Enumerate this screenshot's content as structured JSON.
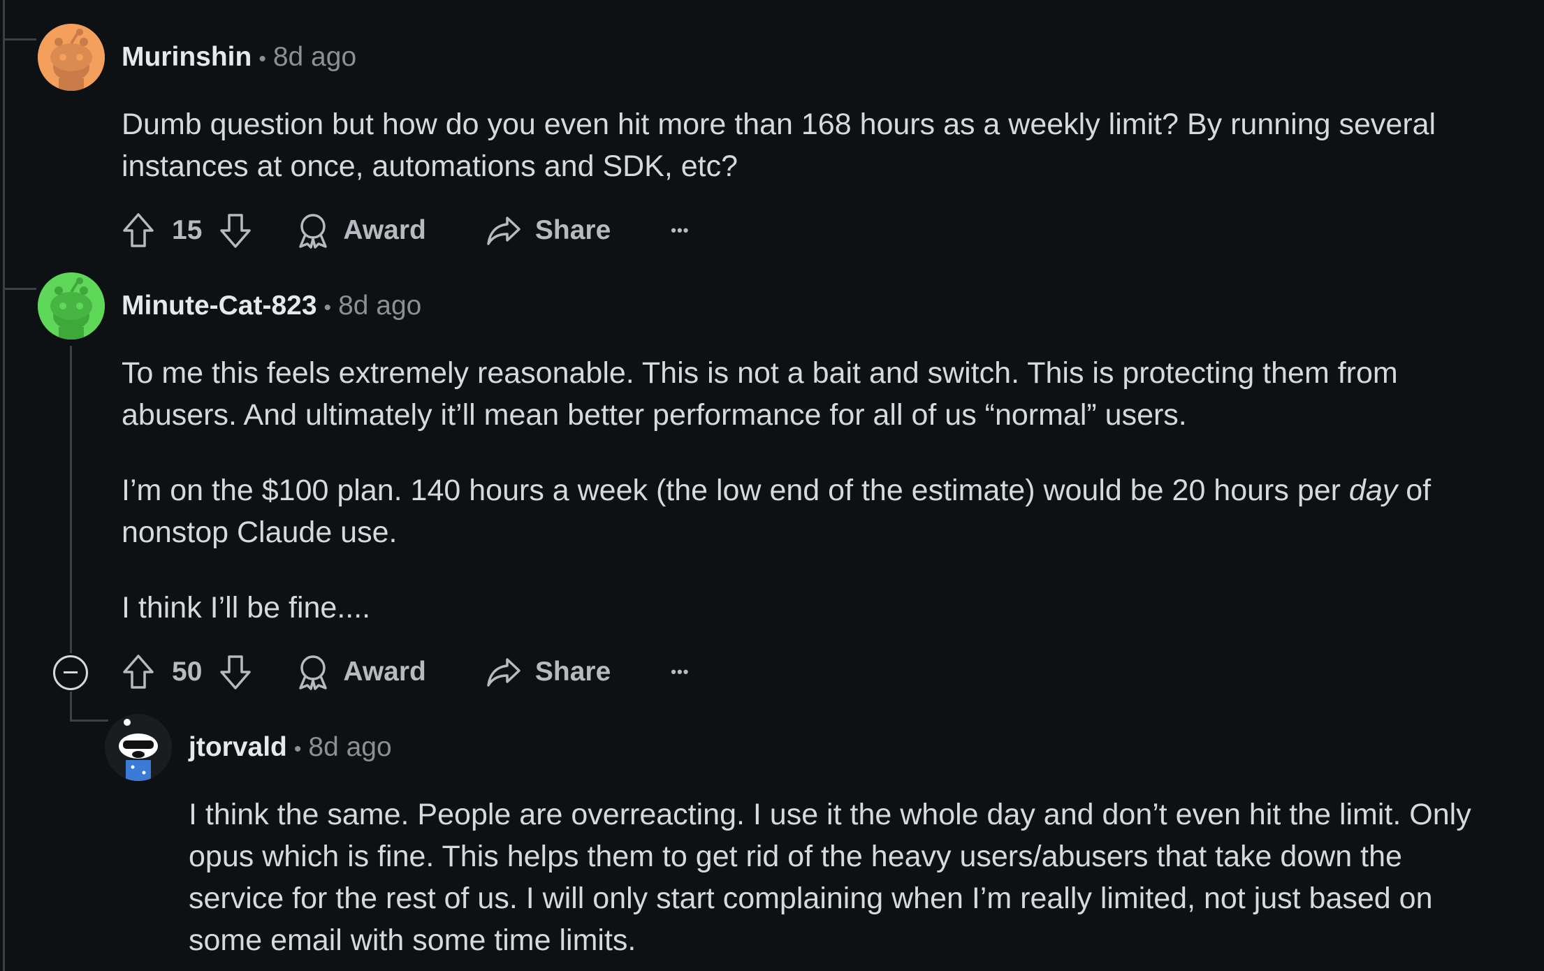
{
  "comments": [
    {
      "username": "Murinshin",
      "separator": "•",
      "time": "8d ago",
      "avatar_color": "#f4a05c",
      "paragraphs": [
        "Dumb question but how do you even hit more than 168 hours as a weekly limit? By running several instances at once, automations and SDK, etc?"
      ],
      "votes": "15",
      "award_label": "Award",
      "share_label": "Share",
      "more_label": "•••"
    },
    {
      "username": "Minute-Cat-823",
      "separator": "•",
      "time": "8d ago",
      "avatar_color": "#5fd85a",
      "paragraphs": [
        "To me this feels extremely reasonable. This is not a bait and switch. This is protecting them from abusers. And ultimately it’ll mean better performance for all of us “normal” users.",
        {
          "before": "I’m on the $100 plan. 140 hours a week (the low end of the estimate) would be 20 hours per ",
          "emphasis": "day",
          "after": " of nonstop Claude use."
        },
        "I think I’ll be fine...."
      ],
      "votes": "50",
      "award_label": "Award",
      "share_label": "Share",
      "more_label": "•••"
    },
    {
      "username": "jtorvald",
      "separator": "•",
      "time": "8d ago",
      "avatar_color": "#1a1d20",
      "paragraphs": [
        "I think the same. People are overreacting. I use it the whole day and don’t even hit the limit. Only opus which is fine. This helps them to get rid of the heavy users/abusers that take down the service for the rest of us. I will only start complaining when I’m really limited, not just based on some email with some time limits."
      ]
    }
  ],
  "icons": {
    "upvote": "upvote-arrow-icon",
    "downvote": "downvote-arrow-icon",
    "award": "award-ribbon-icon",
    "share": "share-arrow-icon",
    "more": "more-horizontal-icon",
    "collapse": "collapse-minus-icon"
  },
  "colors": {
    "background": "#0e1113",
    "text": "#d7dadc",
    "muted": "#8b9094",
    "threadline": "#3a4044"
  }
}
